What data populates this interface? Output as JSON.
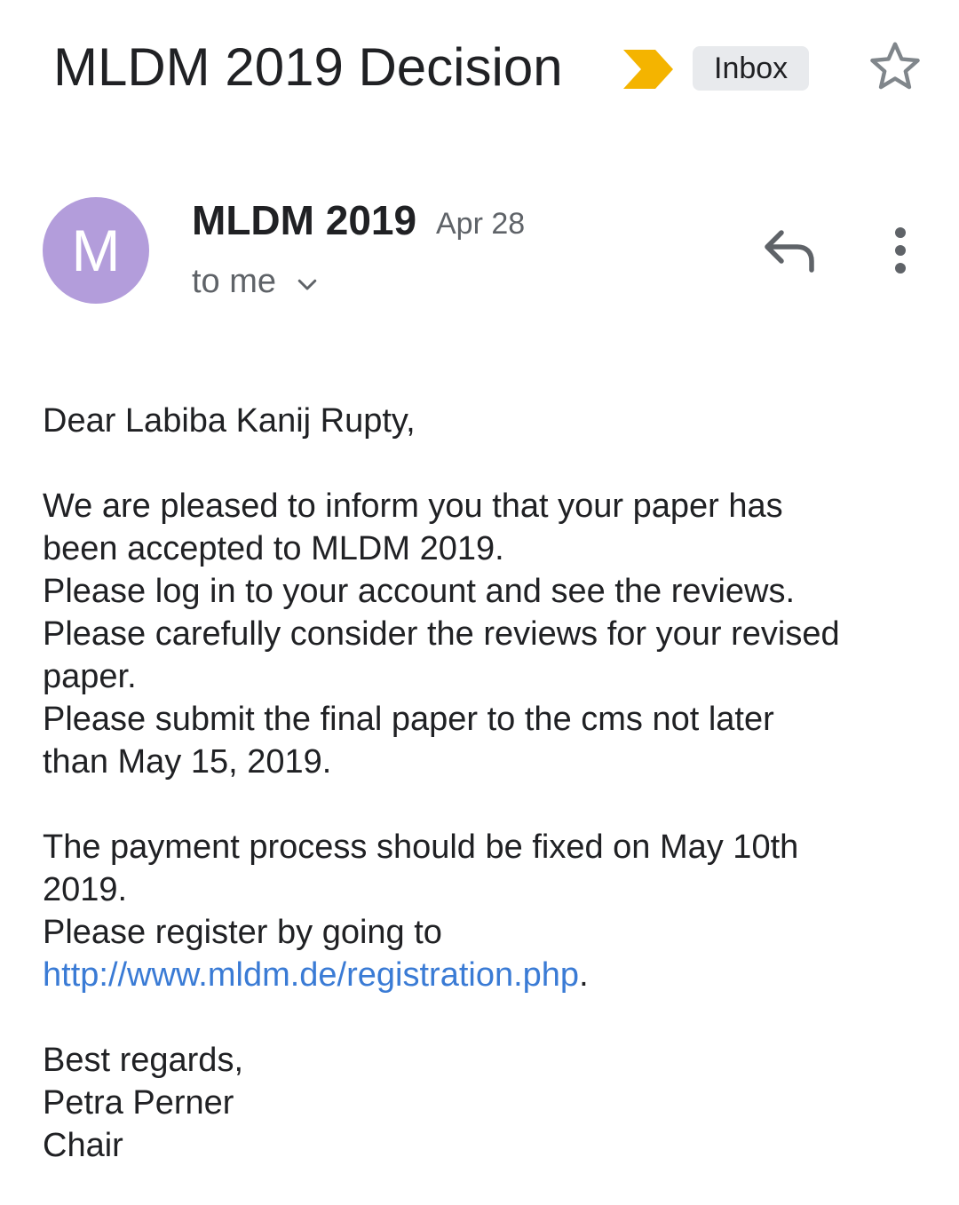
{
  "email": {
    "subject": "MLDM 2019 Decision",
    "importance_icon": "importance-marker-icon",
    "importance_color": "#f4b400",
    "label": "Inbox",
    "star_icon": "star-outline-icon",
    "sender": {
      "avatar_letter": "M",
      "avatar_color": "#b39ddb",
      "name": "MLDM 2019",
      "date": "Apr 28",
      "recipient": "to me",
      "expand_icon": "chevron-down-icon",
      "reply_icon": "reply-icon",
      "more_icon": "more-vert-icon"
    },
    "body": {
      "greeting": "Dear Labiba Kanij Rupty,",
      "para1_line1": "We are pleased to inform you that your paper has",
      "para1_line2": "been accepted to MLDM 2019.",
      "para1_line3": "Please log in to your account and see the reviews.",
      "para1_line4": "Please carefully consider the reviews for your revised",
      "para1_line5": "paper.",
      "para1_line6": "Please submit the final paper to the cms not later",
      "para1_line7": "than May 15, 2019.",
      "para2_line1": "The payment process should be fixed on May 10th",
      "para2_line2": "2019.",
      "para2_line3": "Please register by going to",
      "link": "http://www.mldm.de/registration.php",
      "link_suffix": ".",
      "link_color": "#3a7bd5",
      "closing": "Best regards,",
      "signer_name": "Petra Perner",
      "signer_title": "Chair"
    }
  }
}
